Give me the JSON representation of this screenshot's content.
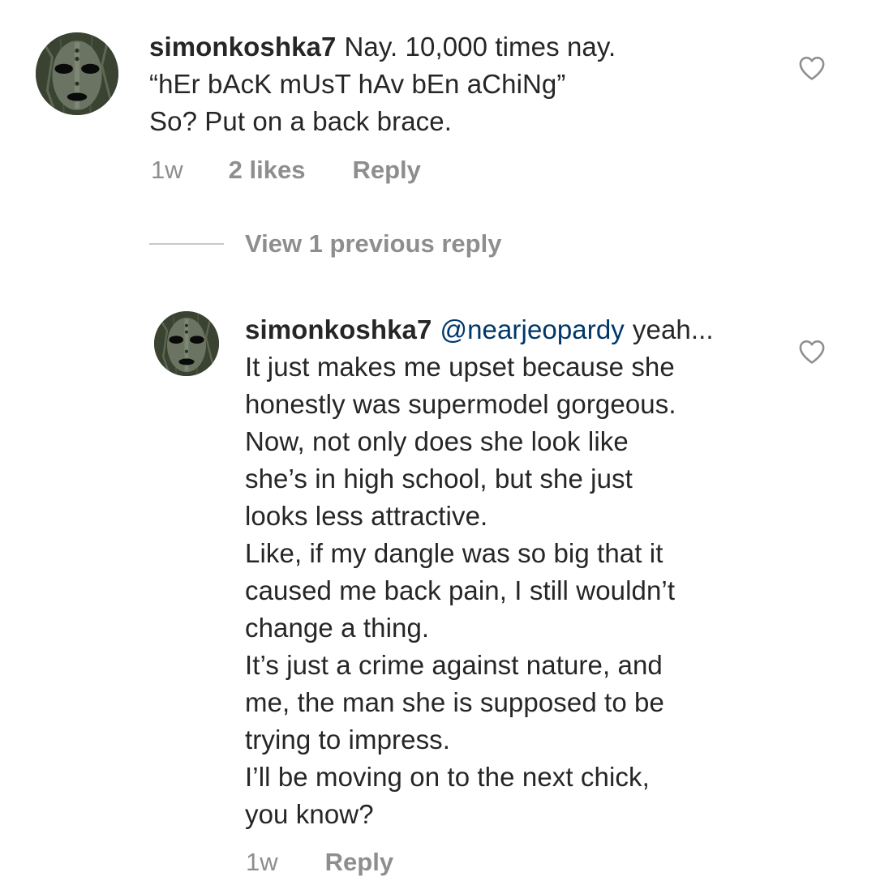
{
  "comment1": {
    "username": "simonkoshka7",
    "lines": [
      "Nay. 10,000 times nay.",
      "“hEr bAcK mUsT hAv bEn aChiNg”",
      "So? Put on a back brace."
    ],
    "time": "1w",
    "likes": "2 likes",
    "reply_label": "Reply",
    "avatar_icon": "wooden-mask-avatar",
    "like_icon": "heart-outline-icon"
  },
  "view_replies": {
    "label": "View 1 previous reply"
  },
  "comment2": {
    "username": "simonkoshka7",
    "mention": "@nearjeopardy",
    "first_line_rest": "yeah...",
    "lines": [
      "It just makes me upset because she",
      "honestly was supermodel gorgeous.",
      "Now, not only does she look like",
      "she’s in high school, but she just",
      "looks less attractive.",
      "Like, if my dangle was so big that it",
      "caused me back pain, I still wouldn’t",
      "change a thing.",
      "It’s just a crime against nature, and",
      "me, the man she is supposed to be",
      "trying to impress.",
      "I’ll be moving on to the next chick,",
      "you know?"
    ],
    "time": "1w",
    "reply_label": "Reply",
    "avatar_icon": "wooden-mask-avatar",
    "like_icon": "heart-outline-icon"
  },
  "colors": {
    "text": "#262626",
    "muted": "#8e8e8e",
    "mention": "#00376b",
    "divider": "#c7c7c7"
  }
}
